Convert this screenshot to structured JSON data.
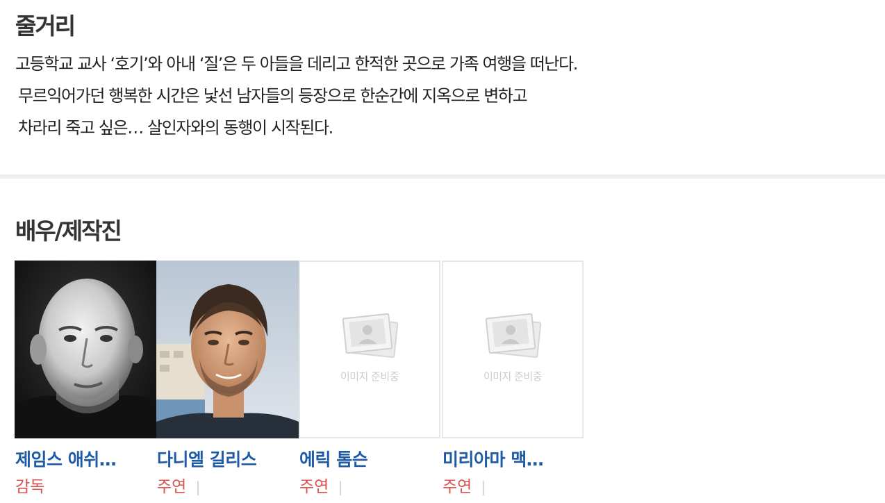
{
  "synopsis": {
    "title": "줄거리",
    "lines": [
      "고등학교 교사 ‘호기’와 아내 ‘질’은 두 아들을 데리고 한적한 곳으로 가족 여행을 떠난다.",
      "무르익어가던 행복한 시간은 낯선 남자들의 등장으로 한순간에 지옥으로 변하고",
      "차라리 죽고 싶은… 살인자와의 동행이 시작된다."
    ]
  },
  "cast": {
    "title": "배우/제작진",
    "placeholder_text": "이미지 준비중",
    "separator": "|",
    "members": [
      {
        "name": "제임스 애쉬…",
        "role": "감독",
        "photo": "bald-man-bw-photo"
      },
      {
        "name": "다니엘 길리스",
        "role": "주연",
        "photo": "man-dark-hair-photo"
      },
      {
        "name": "에릭 톰슨",
        "role": "주연",
        "photo": "placeholder"
      },
      {
        "name": "미리아마 맥…",
        "role": "주연",
        "photo": "placeholder"
      }
    ]
  },
  "colors": {
    "name_link": "#1f5aa6",
    "role": "#d9534f",
    "divider": "#eeeeee"
  }
}
